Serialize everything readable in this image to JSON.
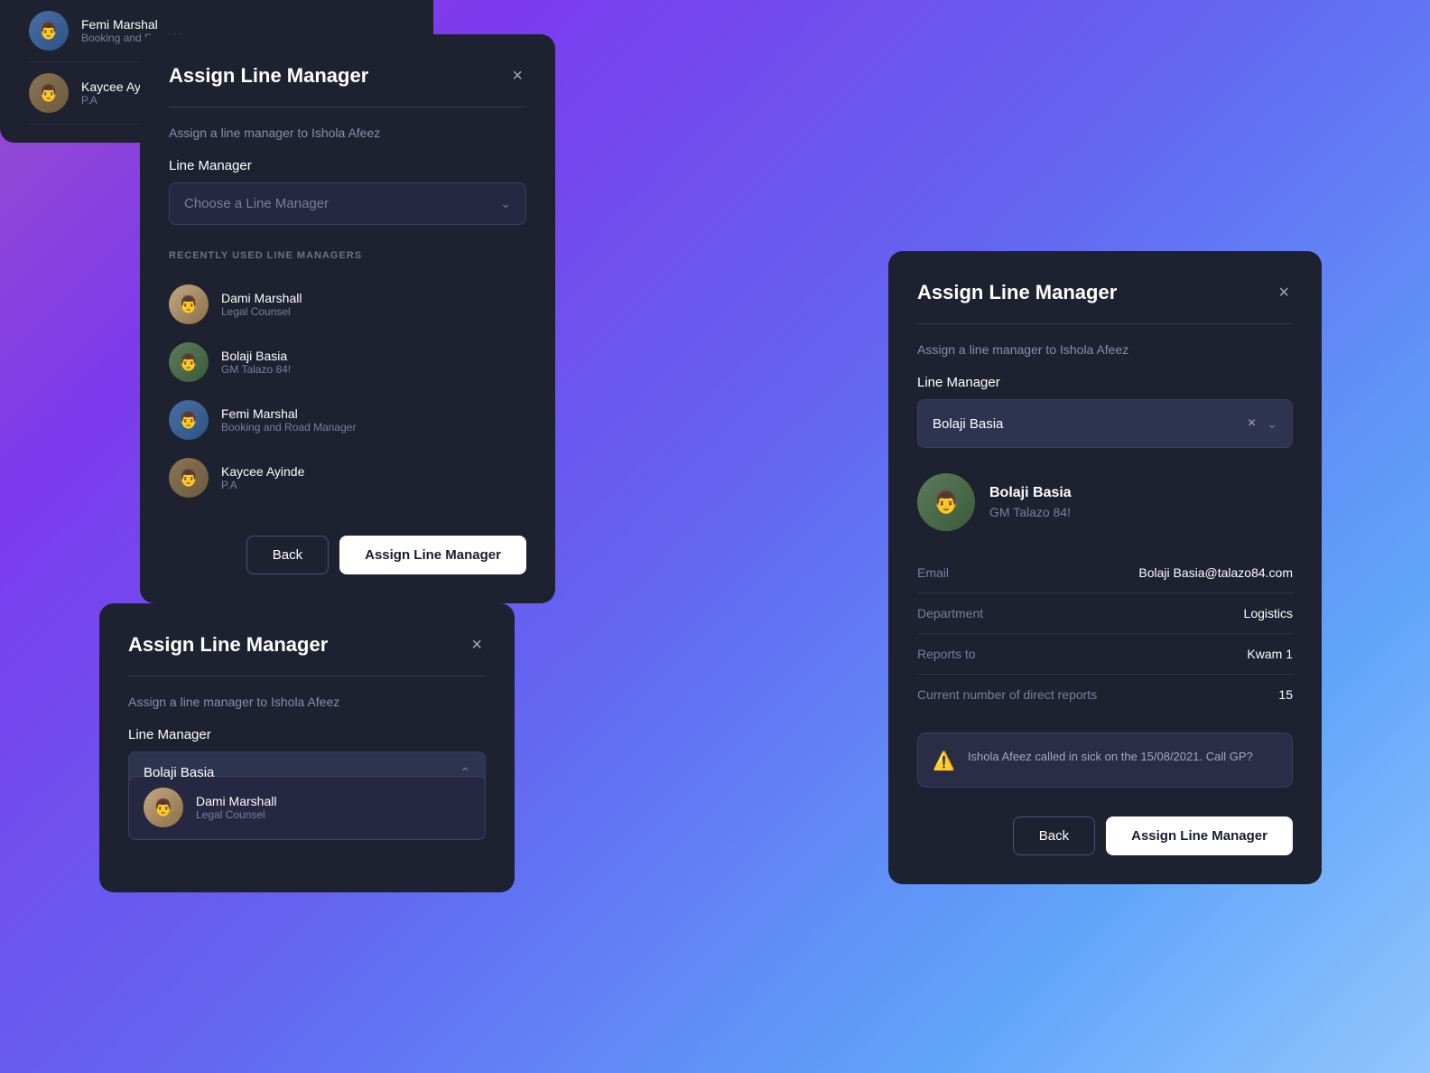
{
  "modals": {
    "modal1": {
      "title": "Assign Line Manager",
      "close_label": "×",
      "subtitle": "Assign a line manager to Ishola Afeez",
      "field_label": "Line Manager",
      "dropdown_placeholder": "Choose a Line Manager",
      "section_title": "RECENTLY USED LINE MANAGERS",
      "managers": [
        {
          "id": "dami",
          "name": "Dami Marshall",
          "role": "Legal Counsel",
          "avatar_color": "av-dami",
          "emoji": "👨"
        },
        {
          "id": "bolaji",
          "name": "Bolaji Basia",
          "role": "GM Talazo 84!",
          "avatar_color": "av-bolaji",
          "emoji": "👨"
        },
        {
          "id": "femi",
          "name": "Femi Marshal",
          "role": "Booking and Road Manager",
          "avatar_color": "av-femi",
          "emoji": "👨"
        },
        {
          "id": "kaycee",
          "name": "Kaycee Ayinde",
          "role": "P.A",
          "avatar_color": "av-kaycee",
          "emoji": "👨"
        }
      ],
      "back_label": "Back",
      "assign_label": "Assign Line Manager"
    },
    "modal2": {
      "title": "Assign Line Manager",
      "close_label": "×",
      "subtitle": "Assign a line manager to Ishola Afeez",
      "field_label": "Line Manager",
      "selected_value": "Bolaji Basia",
      "dropdown_open": true,
      "dropdown_items": [
        {
          "id": "dami",
          "name": "Dami Marshall",
          "role": "Legal Counsel",
          "avatar_color": "av-dami",
          "emoji": "👨"
        }
      ],
      "back_label": "Back",
      "assign_label": "Assign Line Manager"
    },
    "modal3": {
      "title": "Assign Line Manager",
      "close_label": "×",
      "subtitle": "Assign a line manager to Ishola Afeez",
      "field_label": "Line Manager",
      "selected_value": "Bolaji Basia",
      "selected_manager": {
        "name": "Bolaji Basia",
        "role": "GM Talazo 84!",
        "avatar_color": "av-bolaji",
        "emoji": "👨"
      },
      "info_rows": [
        {
          "label": "Email",
          "value": "Bolaji Basia@talazo84.com"
        },
        {
          "label": "Department",
          "value": "Logistics"
        },
        {
          "label": "Reports to",
          "value": "Kwam 1"
        },
        {
          "label": "Current number of direct reports",
          "value": "15"
        }
      ],
      "warning": "Ishola Afeez called in sick on the 15/08/2021. Call GP?",
      "back_label": "Back",
      "assign_label": "Assign Line Manager"
    },
    "modal_top_right": {
      "managers": [
        {
          "id": "femi",
          "name": "Femi Marshal",
          "role": "Booking and Road Manager",
          "avatar_color": "av-femi",
          "emoji": "👨"
        },
        {
          "id": "kaycee",
          "name": "Kaycee Ayinde",
          "role": "P.A",
          "avatar_color": "av-kaycee",
          "emoji": "👨"
        }
      ]
    }
  }
}
